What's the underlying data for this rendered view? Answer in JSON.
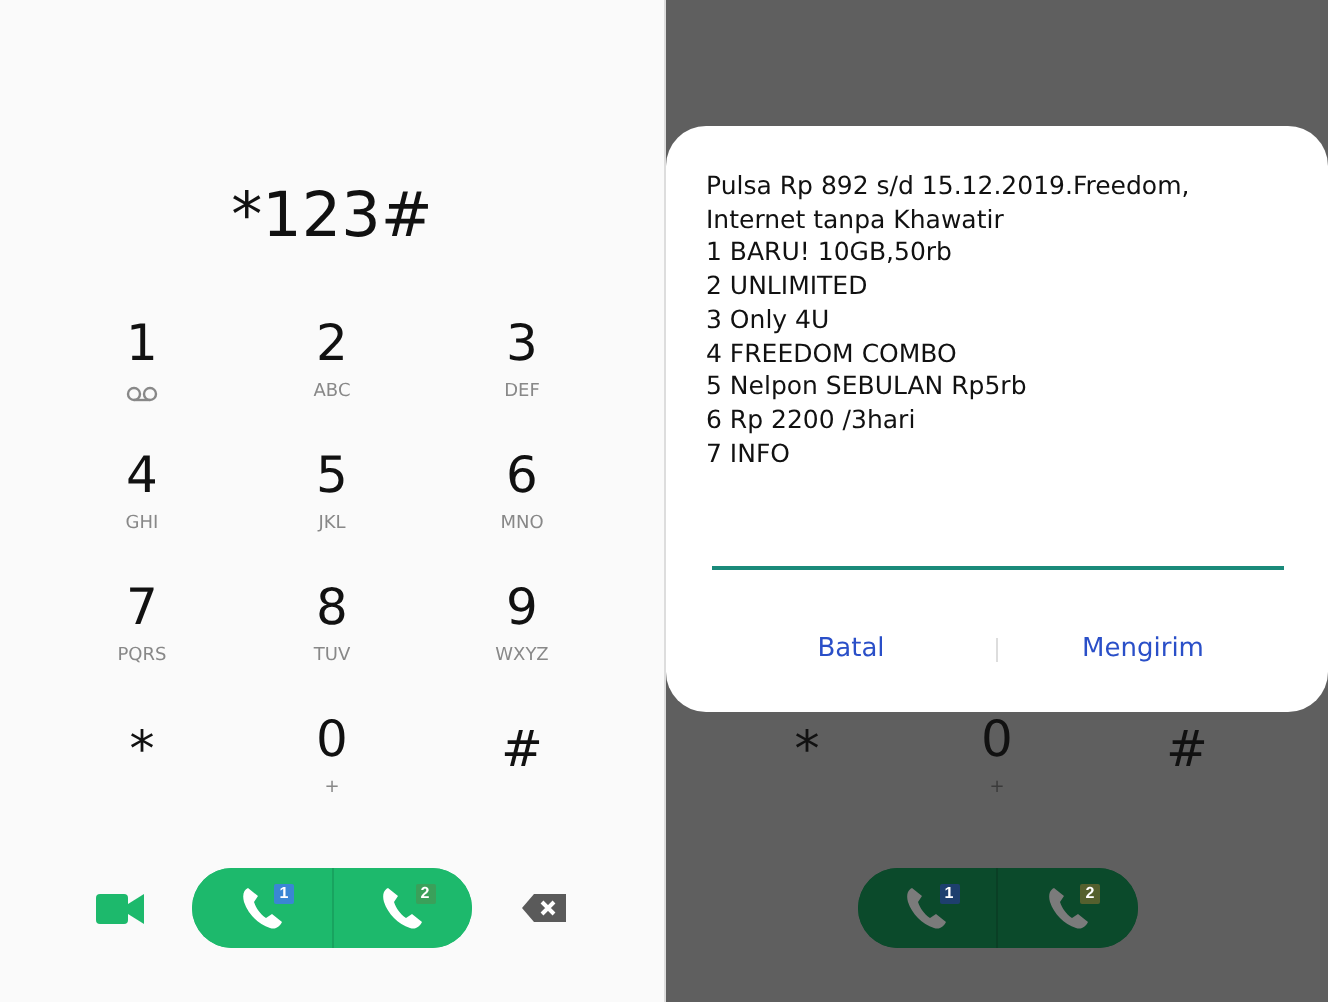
{
  "screens": [
    {
      "dimmed": false,
      "number": "*123#",
      "keys": [
        {
          "digit": "1",
          "kind": "voicemail"
        },
        {
          "digit": "2",
          "letters": "ABC"
        },
        {
          "digit": "3",
          "letters": "DEF"
        },
        {
          "digit": "4",
          "letters": "GHI"
        },
        {
          "digit": "5",
          "letters": "JKL"
        },
        {
          "digit": "6",
          "letters": "MNO"
        },
        {
          "digit": "7",
          "letters": "PQRS"
        },
        {
          "digit": "8",
          "letters": "TUV"
        },
        {
          "digit": "9",
          "letters": "WXYZ"
        },
        {
          "digit": "*",
          "kind": "symbol"
        },
        {
          "digit": "0",
          "letters": "+"
        },
        {
          "digit": "#",
          "kind": "symbol"
        }
      ],
      "video_call": true,
      "backspace": true,
      "sims": [
        {
          "label": "1",
          "color": "#3a86d4"
        },
        {
          "label": "2",
          "color": "#3aa05a"
        }
      ]
    },
    {
      "dimmed": true,
      "keys": [
        {
          "digit": "*",
          "kind": "symbol"
        },
        {
          "digit": "0",
          "letters": "+"
        },
        {
          "digit": "#",
          "kind": "symbol"
        }
      ],
      "video_call": false,
      "backspace": false,
      "sims": [
        {
          "label": "1",
          "color": "#1e3f6e"
        },
        {
          "label": "2",
          "color": "#55602e"
        }
      ],
      "dialog": {
        "message_lines": [
          "Pulsa Rp 892 s/d 15.12.2019.Freedom,",
          "Internet tanpa Khawatir",
          "1 BARU! 10GB,50rb",
          "2 UNLIMITED",
          "3 Only 4U",
          "4 FREEDOM COMBO",
          "5 Nelpon SEBULAN Rp5rb",
          "6 Rp 2200 /3hari",
          "7 INFO"
        ],
        "buttons": [
          "Batal",
          "Mengirim"
        ]
      }
    }
  ]
}
